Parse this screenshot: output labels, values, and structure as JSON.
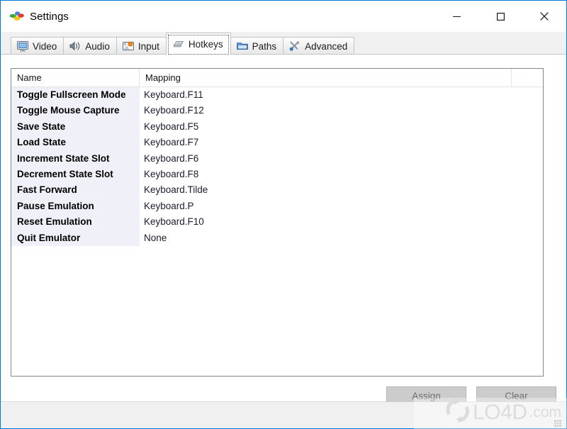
{
  "window": {
    "title": "Settings",
    "app_icon": "settings-dots-icon",
    "minimize_label": "Minimize",
    "maximize_label": "Maximize",
    "close_label": "Close",
    "accent_border": "#0078d7"
  },
  "tabs": [
    {
      "label": "Video",
      "icon": "monitor-icon",
      "active": false
    },
    {
      "label": "Audio",
      "icon": "speaker-icon",
      "active": false
    },
    {
      "label": "Input",
      "icon": "gamepad-icon",
      "active": false
    },
    {
      "label": "Hotkeys",
      "icon": "keyboard-icon",
      "active": true
    },
    {
      "label": "Paths",
      "icon": "folder-icon",
      "active": false
    },
    {
      "label": "Advanced",
      "icon": "tools-icon",
      "active": false
    }
  ],
  "hotkeys_table": {
    "columns": [
      "Name",
      "Mapping"
    ],
    "rows": [
      {
        "name": "Toggle Fullscreen Mode",
        "mapping": "Keyboard.F11"
      },
      {
        "name": "Toggle Mouse Capture",
        "mapping": "Keyboard.F12"
      },
      {
        "name": "Save State",
        "mapping": "Keyboard.F5"
      },
      {
        "name": "Load State",
        "mapping": "Keyboard.F7"
      },
      {
        "name": "Increment State Slot",
        "mapping": "Keyboard.F6"
      },
      {
        "name": "Decrement State Slot",
        "mapping": "Keyboard.F8"
      },
      {
        "name": "Fast Forward",
        "mapping": "Keyboard.Tilde"
      },
      {
        "name": "Pause Emulation",
        "mapping": "Keyboard.P"
      },
      {
        "name": "Reset Emulation",
        "mapping": "Keyboard.F10"
      },
      {
        "name": "Quit Emulator",
        "mapping": "None"
      }
    ],
    "name_column_bg": "#f0f0f8"
  },
  "actions": {
    "assign_label": "Assign",
    "clear_label": "Clear",
    "disabled": true
  },
  "watermark": {
    "brand": "LO4D",
    "suffix": ".com",
    "icon": "circular-arrows-icon"
  }
}
